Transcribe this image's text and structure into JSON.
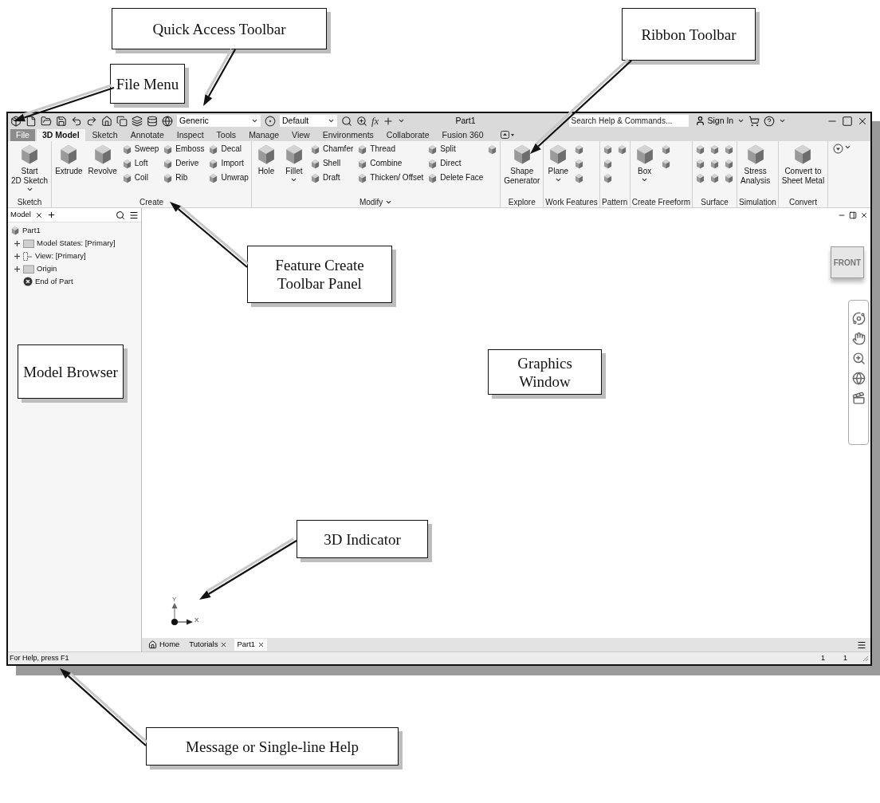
{
  "title_bar": {
    "material": "Generic",
    "appearance": "Default",
    "formula_button": "fx",
    "document_title": "Part1",
    "search": {
      "placeholder": "Search Help & Commands..."
    },
    "sign_in": "Sign In"
  },
  "menu_tabs": [
    {
      "label": "File",
      "kind": "file",
      "selected": false
    },
    {
      "label": "3D Model",
      "kind": "tab",
      "selected": true
    },
    {
      "label": "Sketch",
      "kind": "tab",
      "selected": false
    },
    {
      "label": "Annotate",
      "kind": "tab",
      "selected": false
    },
    {
      "label": "Inspect",
      "kind": "tab",
      "selected": false
    },
    {
      "label": "Tools",
      "kind": "tab",
      "selected": false
    },
    {
      "label": "Manage",
      "kind": "tab",
      "selected": false
    },
    {
      "label": "View",
      "kind": "tab",
      "selected": false
    },
    {
      "label": "Environments",
      "kind": "tab",
      "selected": false
    },
    {
      "label": "Collaborate",
      "kind": "tab",
      "selected": false
    },
    {
      "label": "Fusion 360",
      "kind": "tab",
      "selected": false
    }
  ],
  "ribbon_panels": [
    {
      "label": "Sketch",
      "menu": false,
      "groups": [
        {
          "kind": "large",
          "label": "Start\n2D Sketch",
          "menu": true
        }
      ]
    },
    {
      "label": "Create",
      "menu": false,
      "groups": [
        {
          "kind": "large",
          "label": "Extrude",
          "menu": false
        },
        {
          "kind": "large",
          "label": "Revolve",
          "menu": false
        },
        {
          "kind": "column",
          "items": [
            {
              "kind": "tool",
              "label": "Sweep"
            },
            {
              "kind": "tool",
              "label": "Loft"
            },
            {
              "kind": "tool",
              "label": "Coil"
            }
          ]
        },
        {
          "kind": "column",
          "items": [
            {
              "kind": "tool",
              "label": "Emboss"
            },
            {
              "kind": "tool",
              "label": "Derive"
            },
            {
              "kind": "tool",
              "label": "Rib"
            }
          ]
        },
        {
          "kind": "column",
          "items": [
            {
              "kind": "tool",
              "label": "Decal"
            },
            {
              "kind": "tool",
              "label": "Import"
            },
            {
              "kind": "tool",
              "label": "Unwrap"
            }
          ]
        }
      ]
    },
    {
      "label": "Modify",
      "menu": true,
      "groups": [
        {
          "kind": "large",
          "label": "Hole",
          "menu": false
        },
        {
          "kind": "large",
          "label": "Fillet",
          "menu": true
        },
        {
          "kind": "column",
          "items": [
            {
              "kind": "tool",
              "label": "Chamfer"
            },
            {
              "kind": "tool",
              "label": "Shell"
            },
            {
              "kind": "tool",
              "label": "Draft"
            }
          ]
        },
        {
          "kind": "column",
          "items": [
            {
              "kind": "tool",
              "label": "Thread"
            },
            {
              "kind": "tool",
              "label": "Combine"
            },
            {
              "kind": "tool",
              "label": "Thicken/ Offset"
            }
          ]
        },
        {
          "kind": "column",
          "items": [
            {
              "kind": "tool",
              "label": "Split"
            },
            {
              "kind": "tool",
              "label": "Direct"
            },
            {
              "kind": "tool",
              "label": "Delete Face"
            }
          ]
        },
        {
          "kind": "column",
          "items": [
            {
              "kind": "icon"
            }
          ]
        }
      ]
    },
    {
      "label": "Explore",
      "menu": false,
      "groups": [
        {
          "kind": "large",
          "label": "Shape\nGenerator",
          "menu": false
        }
      ]
    },
    {
      "label": "Work Features",
      "menu": false,
      "groups": [
        {
          "kind": "large",
          "label": "Plane",
          "menu": true
        },
        {
          "kind": "column",
          "items": [
            {
              "kind": "icon"
            },
            {
              "kind": "icon"
            },
            {
              "kind": "icon"
            }
          ]
        }
      ]
    },
    {
      "label": "Pattern",
      "menu": false,
      "groups": [
        {
          "kind": "column",
          "items": [
            {
              "kind": "icon"
            },
            {
              "kind": "icon"
            },
            {
              "kind": "icon"
            }
          ]
        },
        {
          "kind": "column",
          "items": [
            {
              "kind": "icon"
            }
          ]
        }
      ]
    },
    {
      "label": "Create Freeform",
      "menu": false,
      "groups": [
        {
          "kind": "large",
          "label": "Box",
          "menu": true
        },
        {
          "kind": "column",
          "items": [
            {
              "kind": "icon"
            },
            {
              "kind": "icon"
            }
          ]
        }
      ]
    },
    {
      "label": "Surface",
      "menu": false,
      "groups": [
        {
          "kind": "column",
          "items": [
            {
              "kind": "icon"
            },
            {
              "kind": "icon"
            },
            {
              "kind": "icon"
            }
          ]
        },
        {
          "kind": "column",
          "items": [
            {
              "kind": "icon"
            },
            {
              "kind": "icon"
            },
            {
              "kind": "icon"
            }
          ]
        },
        {
          "kind": "column",
          "items": [
            {
              "kind": "icon"
            },
            {
              "kind": "icon"
            },
            {
              "kind": "icon"
            }
          ]
        }
      ]
    },
    {
      "label": "Simulation",
      "menu": false,
      "groups": [
        {
          "kind": "large",
          "label": "Stress\nAnalysis",
          "menu": false
        }
      ]
    },
    {
      "label": "Convert",
      "menu": false,
      "groups": [
        {
          "kind": "large",
          "label": "Convert to\nSheet Metal",
          "menu": false
        }
      ]
    }
  ],
  "browser": {
    "tab": "Model",
    "tree": [
      {
        "label": "Part1",
        "kind": "part",
        "children": [
          {
            "label": "Model States: [Primary]",
            "kind": "folder",
            "expanded": false
          },
          {
            "label": "View: [Primary]",
            "kind": "view",
            "expanded": false
          },
          {
            "label": "Origin",
            "kind": "folder",
            "expanded": false
          },
          {
            "label": "End of Part",
            "kind": "end"
          }
        ]
      }
    ]
  },
  "graphics": {
    "view_cube": "FRONT",
    "axes": {
      "y": "Y",
      "x": "X"
    }
  },
  "document_tabs": [
    {
      "label": "Home",
      "kind": "home",
      "selected": false
    },
    {
      "label": "Tutorials",
      "kind": "doc",
      "selected": false
    },
    {
      "label": "Part1",
      "kind": "doc",
      "selected": true
    }
  ],
  "status_bar": {
    "message": "For Help, press F1",
    "cells": [
      "1",
      "1"
    ]
  },
  "callouts": [
    {
      "text": "File Menu"
    },
    {
      "text": "Quick Access Toolbar"
    },
    {
      "text": "Ribbon Toolbar"
    },
    {
      "text": "Feature Create Toolbar Panel"
    },
    {
      "text": "Model Browser"
    },
    {
      "text": "Graphics Window"
    },
    {
      "text": "3D Indicator"
    },
    {
      "text": "Message or Single-line Help"
    }
  ]
}
